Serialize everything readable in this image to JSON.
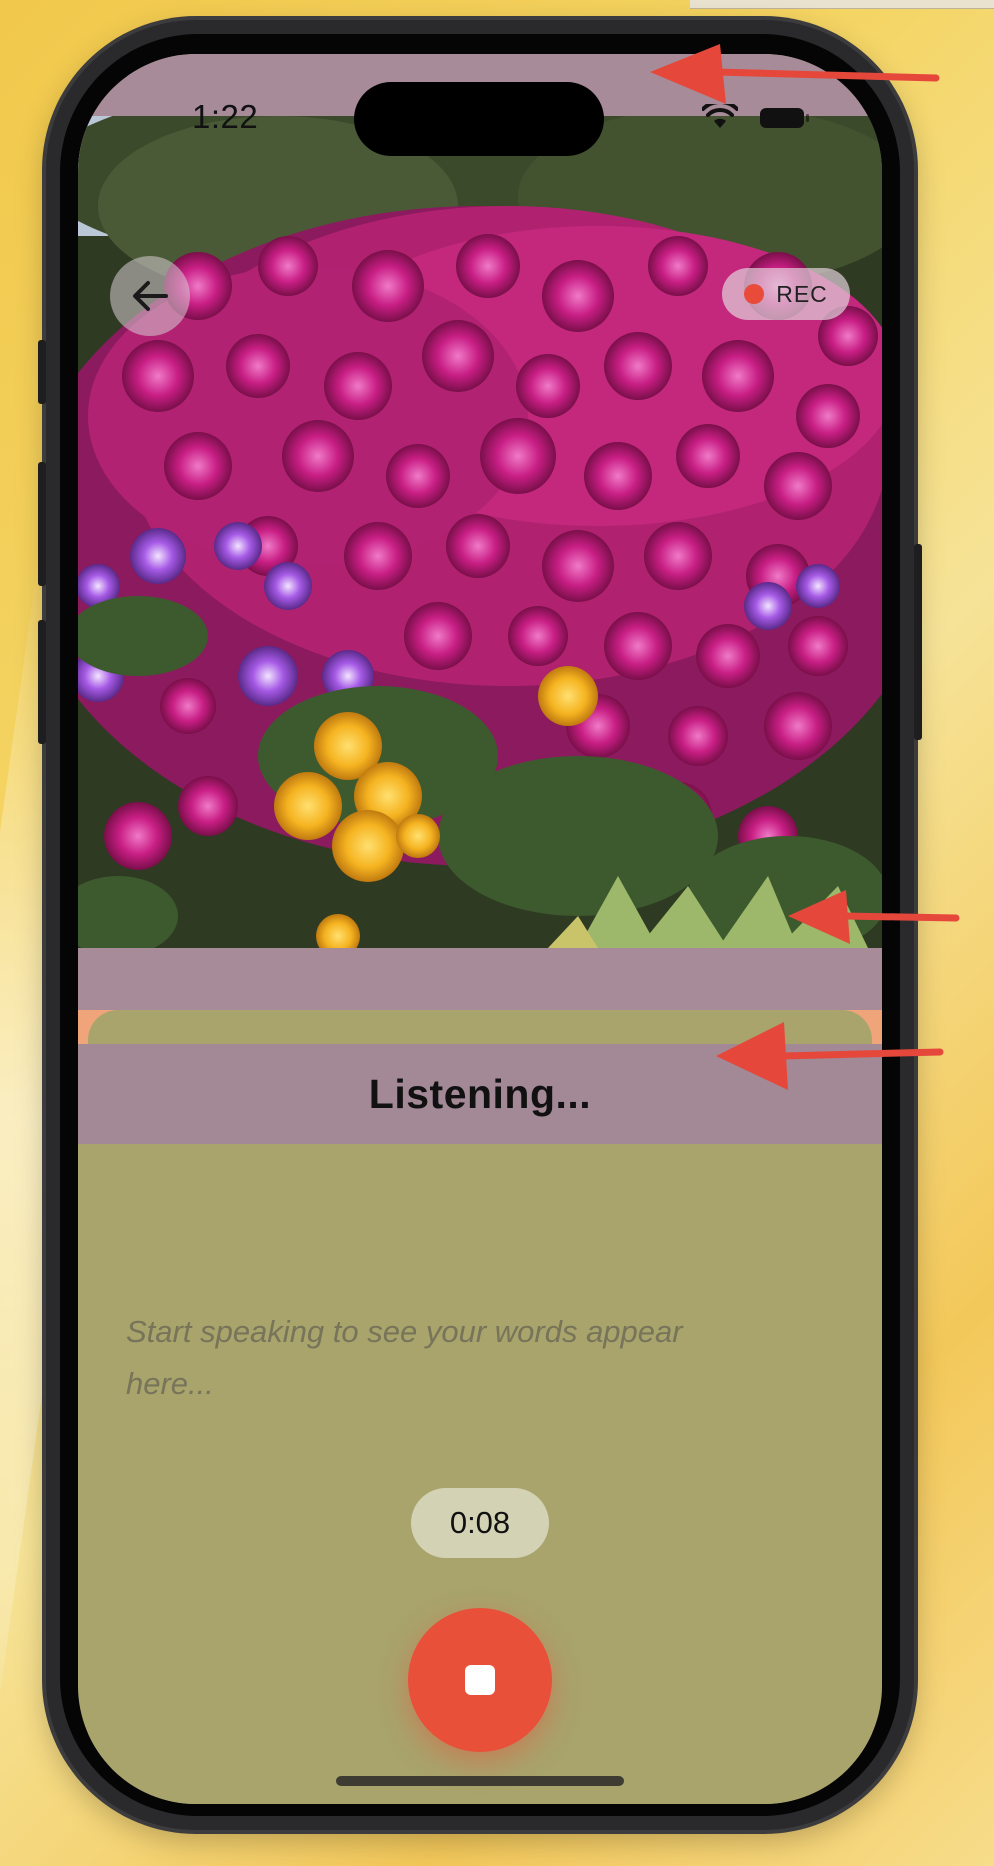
{
  "status_bar": {
    "time": "1:22",
    "wifi_icon": "wifi-icon",
    "battery_icon": "battery-icon"
  },
  "camera": {
    "back_icon": "arrow-left-icon",
    "rec_label": "REC",
    "rec_dot_color": "#e84b3a"
  },
  "panel": {
    "title": "Listening...",
    "placeholder": "Start speaking to see your words appear here...",
    "timer": "0:08",
    "stop_icon": "stop-icon"
  },
  "colors": {
    "highlight_band": "#a78b99",
    "sheet_background": "#a8a46c",
    "stop_button": "#e8503a",
    "annotation_arrow": "#e5483b"
  },
  "annotations": {
    "arrow_icon": "arrow-left-icon",
    "count": 3
  }
}
